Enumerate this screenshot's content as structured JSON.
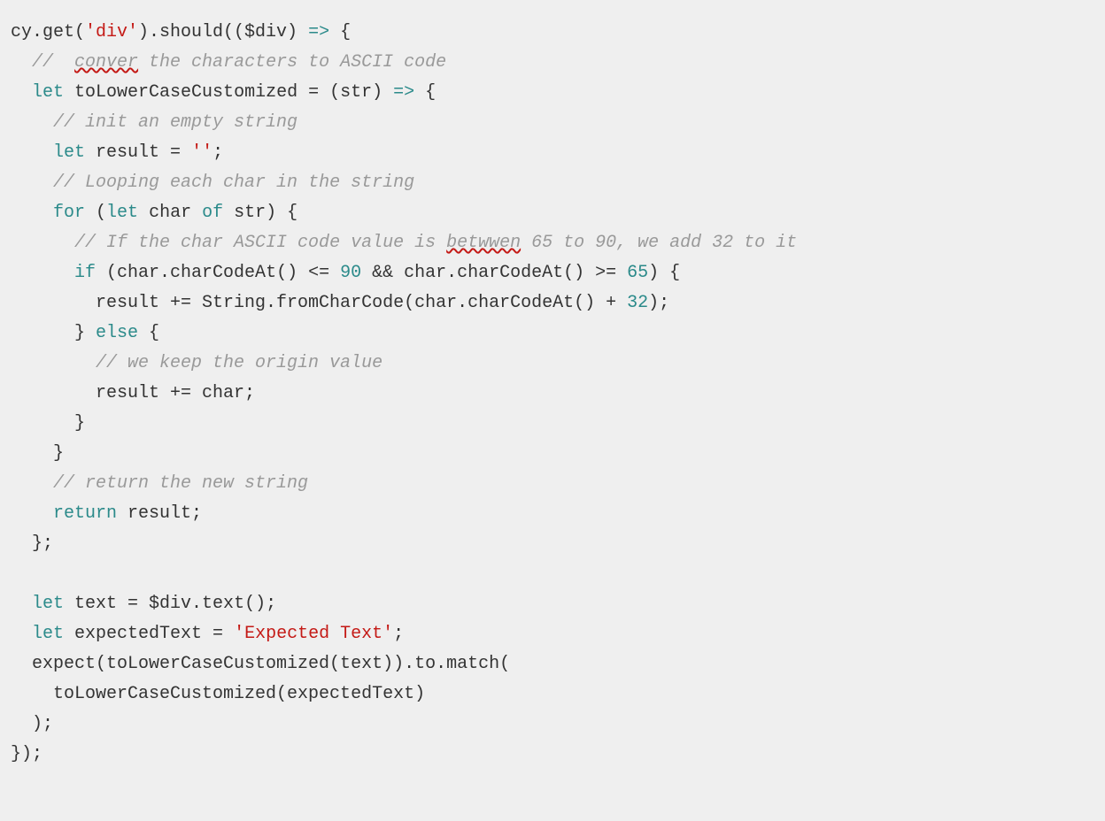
{
  "code": {
    "l1": {
      "a": "cy.get(",
      "b": "'div'",
      "c": ").should(($div) ",
      "d": "=>",
      "e": " {"
    },
    "l2": {
      "a": "  ",
      "b": "//  ",
      "c": "conver",
      "d": " the characters to ASCII code"
    },
    "l3": {
      "a": "  ",
      "b": "let",
      "c": " toLowerCaseCustomized = (str) ",
      "d": "=>",
      "e": " {"
    },
    "l4": {
      "a": "    ",
      "b": "// init an empty string"
    },
    "l5": {
      "a": "    ",
      "b": "let",
      "c": " result = ",
      "d": "''",
      "e": ";"
    },
    "l6": {
      "a": "    ",
      "b": "// Looping each char in the string"
    },
    "l7": {
      "a": "    ",
      "b": "for",
      "c": " (",
      "d": "let",
      "e": " char ",
      "f": "of",
      "g": " str) {"
    },
    "l8": {
      "a": "      ",
      "b": "// If the char ASCII code value is ",
      "c": "betwwen",
      "d": " 65 to 90, we add 32 to it"
    },
    "l9": {
      "a": "      ",
      "b": "if",
      "c": " (char.charCodeAt() <= ",
      "d": "90",
      "e": " && char.charCodeAt() >= ",
      "f": "65",
      "g": ") {"
    },
    "l10": {
      "a": "        result += String.fromCharCode(char.charCodeAt() + ",
      "b": "32",
      "c": ");"
    },
    "l11": {
      "a": "      } ",
      "b": "else",
      "c": " {"
    },
    "l12": {
      "a": "        ",
      "b": "// we keep the origin value"
    },
    "l13": {
      "a": "        result += char;"
    },
    "l14": {
      "a": "      }"
    },
    "l15": {
      "a": "    }"
    },
    "l16": {
      "a": "    ",
      "b": "// return the new string"
    },
    "l17": {
      "a": "    ",
      "b": "return",
      "c": " result;"
    },
    "l18": {
      "a": "  };"
    },
    "l19": {
      "a": ""
    },
    "l20": {
      "a": "  ",
      "b": "let",
      "c": " text = $div.text();"
    },
    "l21": {
      "a": "  ",
      "b": "let",
      "c": " expectedText = ",
      "d": "'Expected Text'",
      "e": ";"
    },
    "l22": {
      "a": "  expect(toLowerCaseCustomized(text)).to.match("
    },
    "l23": {
      "a": "    toLowerCaseCustomized(expectedText)"
    },
    "l24": {
      "a": "  );"
    },
    "l25": {
      "a": "});"
    }
  }
}
